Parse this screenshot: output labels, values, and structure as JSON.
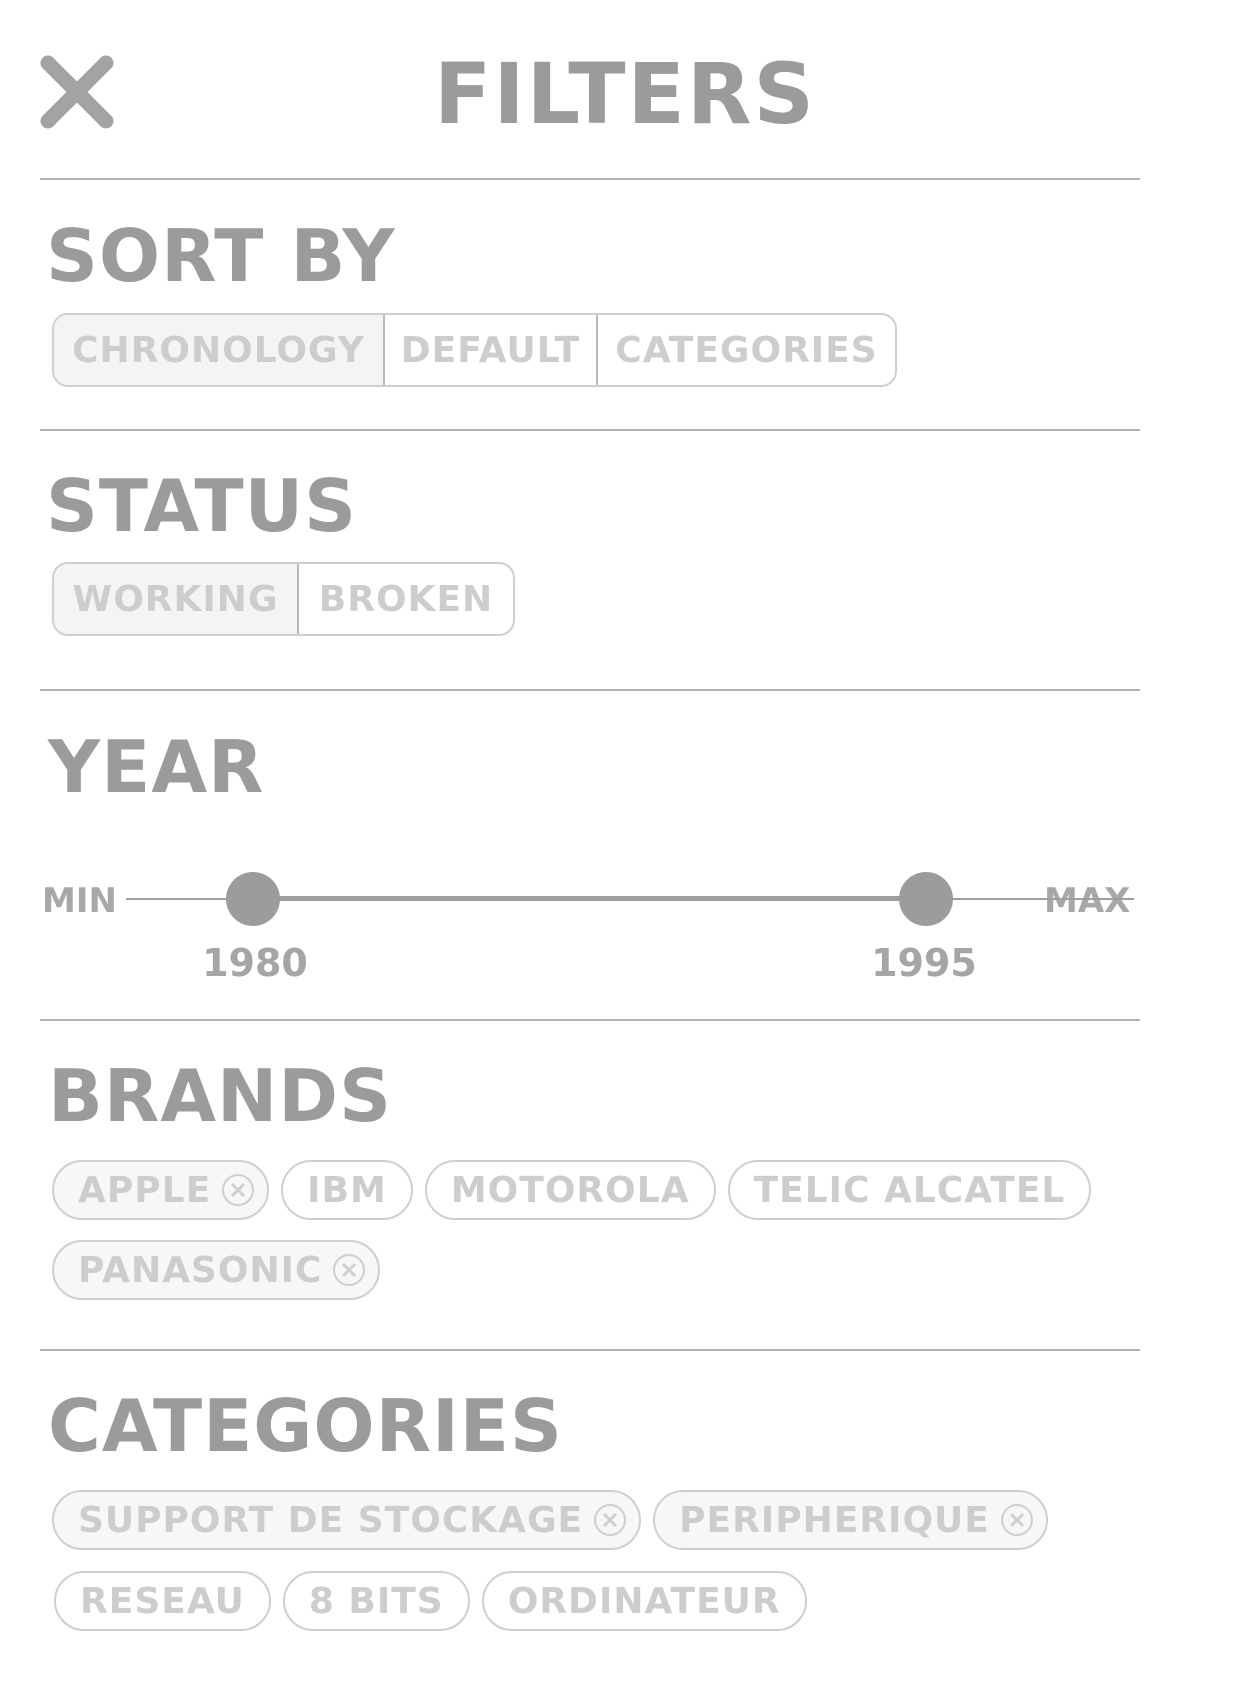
{
  "header": {
    "title": "FILTERS",
    "close_icon": "close-icon"
  },
  "sort_by": {
    "title": "SORT BY",
    "options": [
      {
        "label": "CHRONOLOGY",
        "active": true
      },
      {
        "label": "DEFAULT",
        "active": false
      },
      {
        "label": "CATEGORIES",
        "active": false
      }
    ]
  },
  "status": {
    "title": "STATUS",
    "options": [
      {
        "label": "WORKING",
        "active": true
      },
      {
        "label": "BROKEN",
        "active": false
      }
    ]
  },
  "year": {
    "title": "YEAR",
    "min_label": "MIN",
    "max_label": "MAX",
    "low_value": "1980",
    "high_value": "1995"
  },
  "brands": {
    "title": "BRANDS",
    "chips": [
      {
        "label": "APPLE",
        "selected": true
      },
      {
        "label": "IBM",
        "selected": false
      },
      {
        "label": "MOTOROLA",
        "selected": false
      },
      {
        "label": "TELIC ALCATEL",
        "selected": false
      },
      {
        "label": "PANASONIC",
        "selected": true
      }
    ]
  },
  "categories": {
    "title": "CATEGORIES",
    "chips": [
      {
        "label": "SUPPORT DE STOCKAGE",
        "selected": true
      },
      {
        "label": "PERIPHERIQUE",
        "selected": true
      },
      {
        "label": "RESEAU",
        "selected": false
      },
      {
        "label": "8 BITS",
        "selected": false
      },
      {
        "label": "ORDINATEUR",
        "selected": false
      }
    ]
  },
  "colors": {
    "heading": "#9b9b9b",
    "muted_text": "#cdcdcd",
    "border": "#cfcfcf",
    "divider": "#b4b4b4",
    "slider": "#9e9e9e"
  }
}
